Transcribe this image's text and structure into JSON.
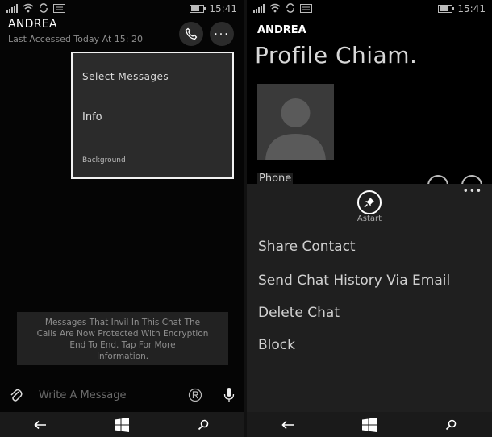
{
  "status": {
    "time": "15:41"
  },
  "chat": {
    "contact_name": "ANDREA",
    "last_accessed": "Last Accessed Today At 15: 20",
    "popup_menu": {
      "select_messages": "Select Messages",
      "info": "Info",
      "background": "Background"
    },
    "encryption_notice": [
      "Messages That Invil In This Chat The",
      "Calls Are Now Protected With Encryption",
      "End To End. Tap For More",
      "Information."
    ],
    "compose_placeholder": "Write A Message"
  },
  "profile": {
    "name": "ANDREA",
    "title": "Profile Chiam.",
    "phone_label": "Phone",
    "pin_label": "Astart",
    "menu_items": [
      "Share Contact",
      "Send Chat History Via Email",
      "Delete Chat",
      "Block"
    ]
  },
  "colors": {
    "popup_border": "#f2f2f2",
    "background": "#000000",
    "panel": "#1f1f1f"
  },
  "icons": [
    "signal-icon",
    "wifi-icon",
    "sync-icon",
    "message-icon",
    "battery-icon",
    "phone-icon",
    "more-icon",
    "attach-icon",
    "emoji-icon",
    "mic-icon",
    "back-icon",
    "windows-icon",
    "search-icon",
    "pin-icon"
  ]
}
